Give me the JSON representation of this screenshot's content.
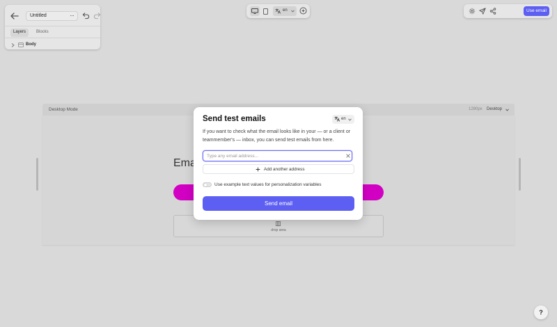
{
  "header": {
    "doc_title": "Untitled",
    "more_label": "···"
  },
  "layers_panel": {
    "tabs": [
      {
        "label": "Layers",
        "active": true
      },
      {
        "label": "Blocks",
        "active": false
      }
    ],
    "items": [
      {
        "label": "Body",
        "icon": "frame-icon"
      }
    ]
  },
  "toolbar": {
    "device_selected": "desktop",
    "language": "en"
  },
  "actions": {
    "use_email_label": "Use email",
    "icons": [
      "gear-icon",
      "send-icon",
      "share-icon"
    ]
  },
  "canvas": {
    "mode_label": "Desktop Mode",
    "width_label": "1280px",
    "device_label": "Desktop",
    "heading_partial": "Ema",
    "drop_area_label": "drop area"
  },
  "modal": {
    "title": "Send test emails",
    "language": "en",
    "description": "If you want to check what the email looks like in your — or a client or teammember's — inbox, you can send test emails from here.",
    "email_placeholder": "Type any email address...",
    "email_value": "",
    "add_address_label": "Add another address",
    "toggle_label": "Use example text values for personalization variables",
    "toggle_on": false,
    "send_label": "Send email"
  },
  "help": {
    "label": "?"
  },
  "colors": {
    "accent": "#5d5ff2",
    "canvas_button": "#d200c3",
    "page_background": "#d9d9d9"
  }
}
